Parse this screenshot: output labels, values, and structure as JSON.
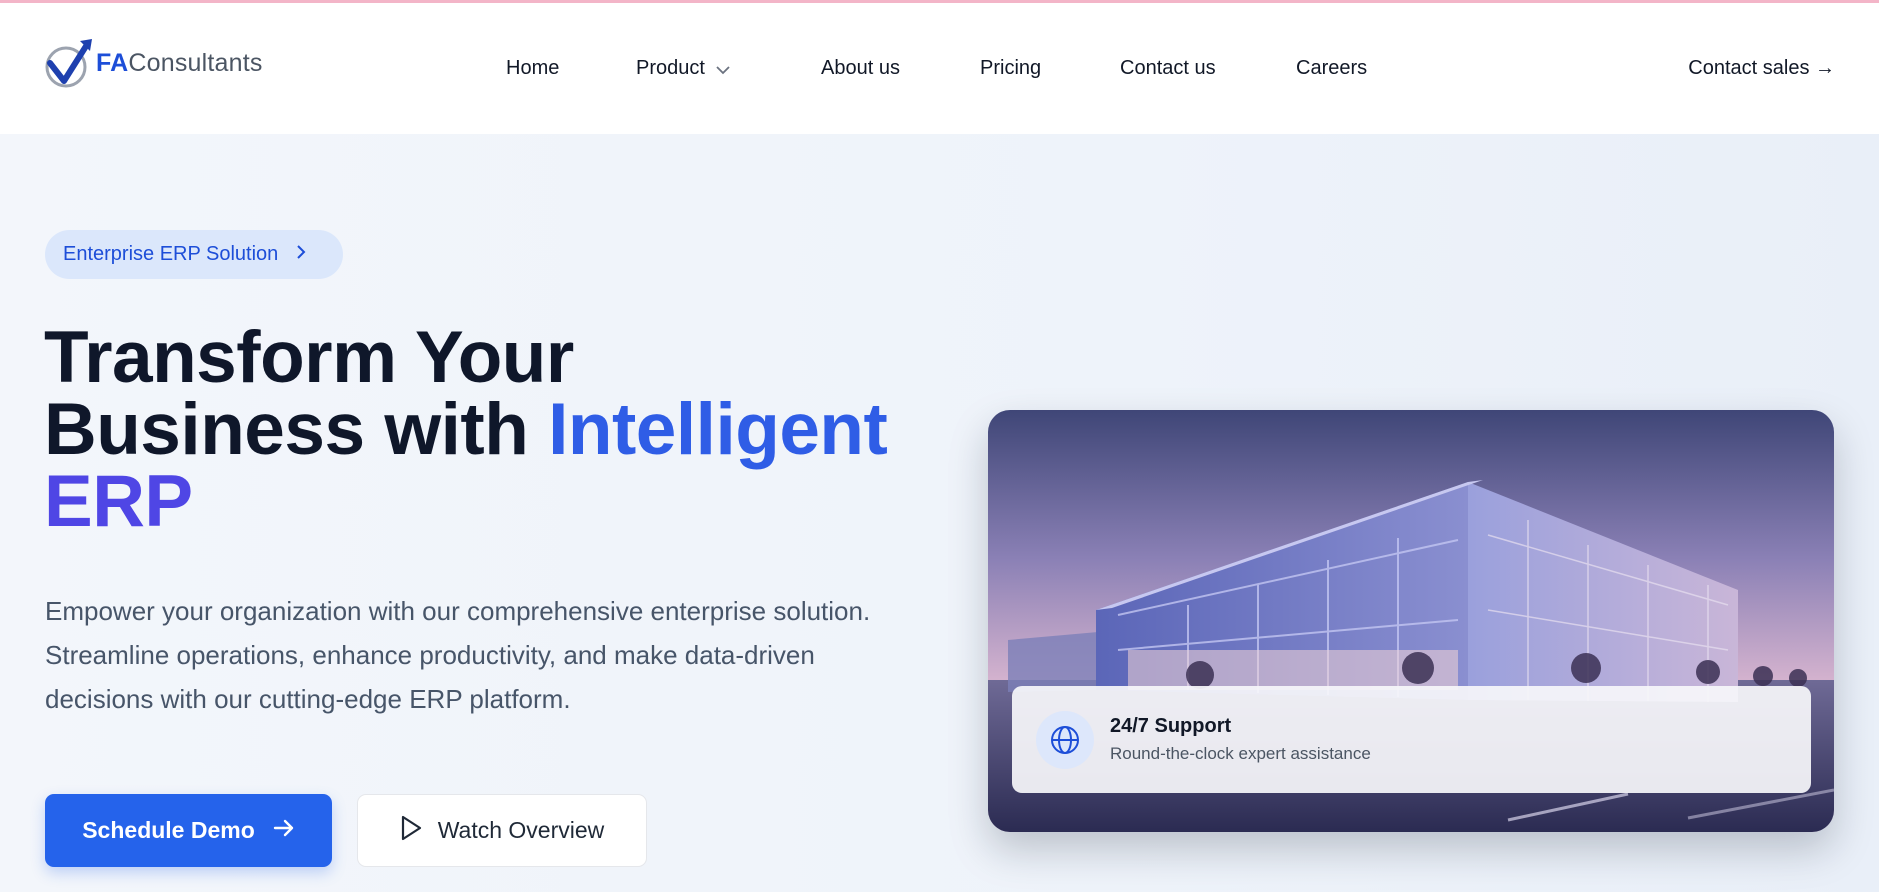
{
  "brand": {
    "logo_prefix": "FA",
    "logo_suffix": "Consultants",
    "accent": "#2563eb"
  },
  "nav": {
    "items": [
      {
        "label": "Home"
      },
      {
        "label": "Product",
        "has_dropdown": true
      },
      {
        "label": "About us"
      },
      {
        "label": "Pricing"
      },
      {
        "label": "Contact us"
      },
      {
        "label": "Careers"
      }
    ],
    "cta": "Contact sales →"
  },
  "hero": {
    "badge": "Enterprise ERP Solution",
    "title_line1": "Transform Your",
    "title_line2": "Business with ",
    "title_highlight": "Intelligent",
    "title_highlight2": "ERP",
    "subtitle": "Empower your organization with our comprehensive enterprise solution. Streamline operations, enhance productivity, and make data-driven decisions with our cutting-edge ERP platform.",
    "primary_button": "Schedule Demo",
    "secondary_button": "Watch Overview"
  },
  "feature_card": {
    "icon": "globe-icon",
    "title": "24/7 Support",
    "description": "Round-the-clock expert assistance"
  }
}
